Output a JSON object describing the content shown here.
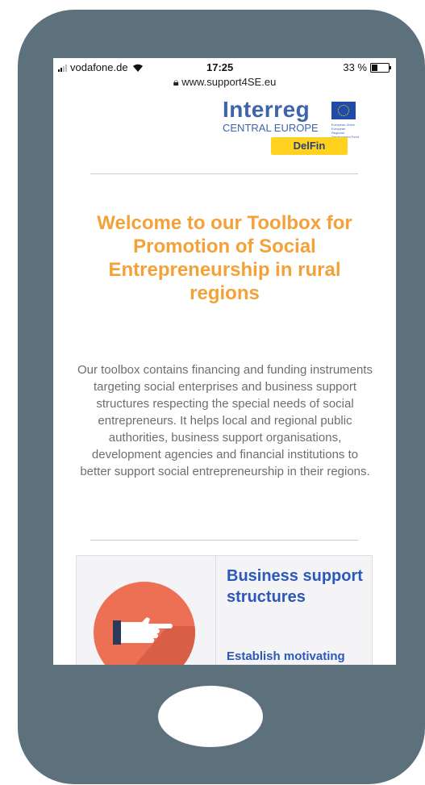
{
  "status": {
    "carrier": "vodafone.de",
    "time": "17:25",
    "battery_label": "33 %",
    "battery_level": 0.33
  },
  "browser": {
    "url": "www.support4SE.eu"
  },
  "logo": {
    "brand": "Interreg",
    "program": "CENTRAL EUROPE",
    "eu_text": "European Union European Regional Development Fund",
    "project": "DelFin"
  },
  "main": {
    "headline": "Welcome to our Toolbox for Promotion of Social Entrepreneurship in rural regions",
    "description": "Our toolbox contains financing and funding instruments targeting social enterprises and business support structures respecting the special needs of social entrepreneurs. It helps local and regional public authorities, business support organisations, development agencies and financial institutions to better support social entrepreneurship in their regions."
  },
  "card": {
    "title": "Business support structures",
    "subtitle": "Establish motivating"
  },
  "colors": {
    "phone_frame": "#5d717c",
    "headline": "#f3a23a",
    "link_blue": "#2c59b7",
    "accent_icon": "#ee7054"
  }
}
